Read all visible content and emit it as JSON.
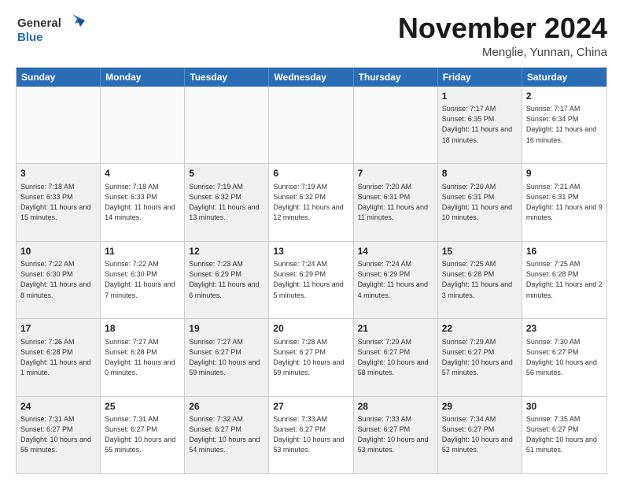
{
  "logo": {
    "general": "General",
    "blue": "Blue",
    "tagline": ""
  },
  "header": {
    "month": "November 2024",
    "location": "Menglie, Yunnan, China"
  },
  "weekdays": [
    "Sunday",
    "Monday",
    "Tuesday",
    "Wednesday",
    "Thursday",
    "Friday",
    "Saturday"
  ],
  "rows": [
    [
      {
        "day": "",
        "text": "",
        "empty": true
      },
      {
        "day": "",
        "text": "",
        "empty": true
      },
      {
        "day": "",
        "text": "",
        "empty": true
      },
      {
        "day": "",
        "text": "",
        "empty": true
      },
      {
        "day": "",
        "text": "",
        "empty": true
      },
      {
        "day": "1",
        "text": "Sunrise: 7:17 AM\nSunset: 6:35 PM\nDaylight: 11 hours and 18 minutes.",
        "shaded": true
      },
      {
        "day": "2",
        "text": "Sunrise: 7:17 AM\nSunset: 6:34 PM\nDaylight: 11 hours and 16 minutes.",
        "shaded": false
      }
    ],
    [
      {
        "day": "3",
        "text": "Sunrise: 7:18 AM\nSunset: 6:33 PM\nDaylight: 11 hours and 15 minutes.",
        "shaded": true
      },
      {
        "day": "4",
        "text": "Sunrise: 7:18 AM\nSunset: 6:33 PM\nDaylight: 11 hours and 14 minutes.",
        "shaded": false
      },
      {
        "day": "5",
        "text": "Sunrise: 7:19 AM\nSunset: 6:32 PM\nDaylight: 11 hours and 13 minutes.",
        "shaded": true
      },
      {
        "day": "6",
        "text": "Sunrise: 7:19 AM\nSunset: 6:32 PM\nDaylight: 11 hours and 12 minutes.",
        "shaded": false
      },
      {
        "day": "7",
        "text": "Sunrise: 7:20 AM\nSunset: 6:31 PM\nDaylight: 11 hours and 11 minutes.",
        "shaded": true
      },
      {
        "day": "8",
        "text": "Sunrise: 7:20 AM\nSunset: 6:31 PM\nDaylight: 11 hours and 10 minutes.",
        "shaded": true
      },
      {
        "day": "9",
        "text": "Sunrise: 7:21 AM\nSunset: 6:31 PM\nDaylight: 11 hours and 9 minutes.",
        "shaded": false
      }
    ],
    [
      {
        "day": "10",
        "text": "Sunrise: 7:22 AM\nSunset: 6:30 PM\nDaylight: 11 hours and 8 minutes.",
        "shaded": true
      },
      {
        "day": "11",
        "text": "Sunrise: 7:22 AM\nSunset: 6:30 PM\nDaylight: 11 hours and 7 minutes.",
        "shaded": false
      },
      {
        "day": "12",
        "text": "Sunrise: 7:23 AM\nSunset: 6:29 PM\nDaylight: 11 hours and 6 minutes.",
        "shaded": true
      },
      {
        "day": "13",
        "text": "Sunrise: 7:24 AM\nSunset: 6:29 PM\nDaylight: 11 hours and 5 minutes.",
        "shaded": false
      },
      {
        "day": "14",
        "text": "Sunrise: 7:24 AM\nSunset: 6:29 PM\nDaylight: 11 hours and 4 minutes.",
        "shaded": true
      },
      {
        "day": "15",
        "text": "Sunrise: 7:25 AM\nSunset: 6:28 PM\nDaylight: 11 hours and 3 minutes.",
        "shaded": true
      },
      {
        "day": "16",
        "text": "Sunrise: 7:25 AM\nSunset: 6:28 PM\nDaylight: 11 hours and 2 minutes.",
        "shaded": false
      }
    ],
    [
      {
        "day": "17",
        "text": "Sunrise: 7:26 AM\nSunset: 6:28 PM\nDaylight: 11 hours and 1 minute.",
        "shaded": true
      },
      {
        "day": "18",
        "text": "Sunrise: 7:27 AM\nSunset: 6:28 PM\nDaylight: 11 hours and 0 minutes.",
        "shaded": false
      },
      {
        "day": "19",
        "text": "Sunrise: 7:27 AM\nSunset: 6:27 PM\nDaylight: 10 hours and 59 minutes.",
        "shaded": true
      },
      {
        "day": "20",
        "text": "Sunrise: 7:28 AM\nSunset: 6:27 PM\nDaylight: 10 hours and 59 minutes.",
        "shaded": false
      },
      {
        "day": "21",
        "text": "Sunrise: 7:29 AM\nSunset: 6:27 PM\nDaylight: 10 hours and 58 minutes.",
        "shaded": true
      },
      {
        "day": "22",
        "text": "Sunrise: 7:29 AM\nSunset: 6:27 PM\nDaylight: 10 hours and 57 minutes.",
        "shaded": true
      },
      {
        "day": "23",
        "text": "Sunrise: 7:30 AM\nSunset: 6:27 PM\nDaylight: 10 hours and 56 minutes.",
        "shaded": false
      }
    ],
    [
      {
        "day": "24",
        "text": "Sunrise: 7:31 AM\nSunset: 6:27 PM\nDaylight: 10 hours and 55 minutes.",
        "shaded": true
      },
      {
        "day": "25",
        "text": "Sunrise: 7:31 AM\nSunset: 6:27 PM\nDaylight: 10 hours and 55 minutes.",
        "shaded": false
      },
      {
        "day": "26",
        "text": "Sunrise: 7:32 AM\nSunset: 6:27 PM\nDaylight: 10 hours and 54 minutes.",
        "shaded": true
      },
      {
        "day": "27",
        "text": "Sunrise: 7:33 AM\nSunset: 6:27 PM\nDaylight: 10 hours and 53 minutes.",
        "shaded": false
      },
      {
        "day": "28",
        "text": "Sunrise: 7:33 AM\nSunset: 6:27 PM\nDaylight: 10 hours and 53 minutes.",
        "shaded": true
      },
      {
        "day": "29",
        "text": "Sunrise: 7:34 AM\nSunset: 6:27 PM\nDaylight: 10 hours and 52 minutes.",
        "shaded": true
      },
      {
        "day": "30",
        "text": "Sunrise: 7:35 AM\nSunset: 6:27 PM\nDaylight: 10 hours and 51 minutes.",
        "shaded": false
      }
    ]
  ]
}
